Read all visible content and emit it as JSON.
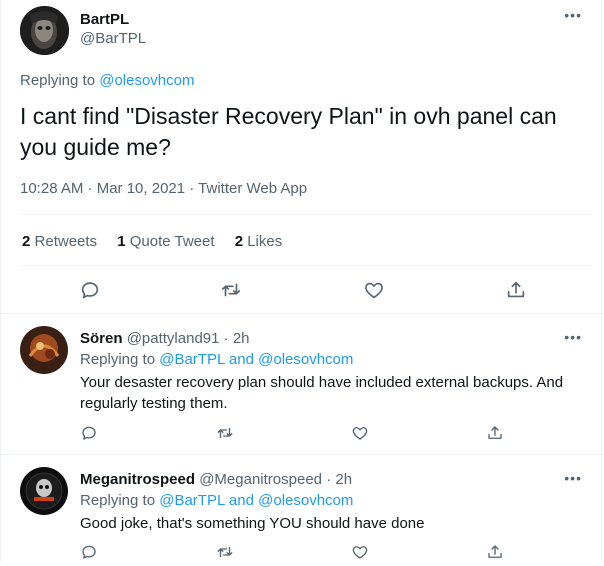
{
  "tweet": {
    "author_name": "BartPL",
    "author_handle": "@BarTPL",
    "replying_prefix": "Replying to",
    "replying_handle": "@olesovhcom",
    "text": "I cant find \"Disaster Recovery Plan\" in ovh panel can you guide me?",
    "meta": "10:28 AM · Mar 10, 2021 · Twitter Web App",
    "stats": [
      {
        "count": "2",
        "label": "Retweets"
      },
      {
        "count": "1",
        "label": "Quote Tweet"
      },
      {
        "count": "2",
        "label": "Likes"
      }
    ],
    "more": "•••"
  },
  "replies": [
    {
      "name": "Sören",
      "handle": "@pattyland91",
      "time": "· 2h",
      "replying_prefix": "Replying to",
      "replying_1": "@BarTPL",
      "replying_and": "and",
      "replying_2": "@olesovhcom",
      "text": "Your desaster recovery plan should have included external backups. And regularly testing them.",
      "more": "•••"
    },
    {
      "name": "Meganitrospeed",
      "handle": "@Meganitrospeed",
      "time": "· 2h",
      "replying_prefix": "Replying to",
      "replying_1": "@BarTPL",
      "replying_and": "and",
      "replying_2": "@olesovhcom",
      "text": "Good joke, that's something YOU should have done",
      "more": "•••"
    }
  ],
  "colors": {
    "accent": "#1d9bf0",
    "muted": "#536471",
    "divider": "#eff3f4"
  }
}
